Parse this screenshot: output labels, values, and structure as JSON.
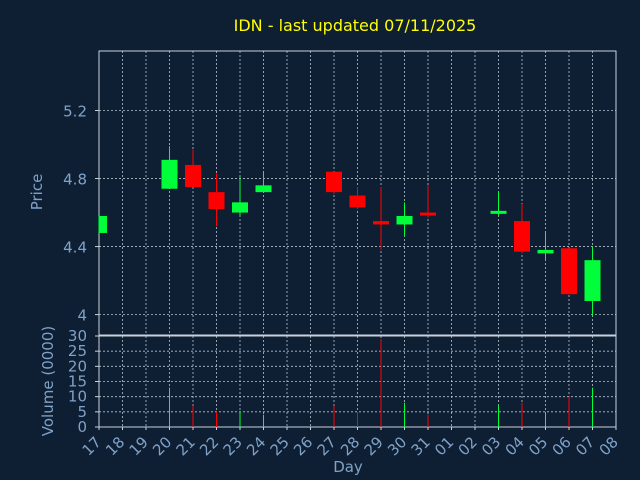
{
  "chart_data": {
    "type": "candlestick",
    "title": "IDN - last updated 07/11/2025",
    "xlabel": "Day",
    "colors": {
      "background": "#0f1f33",
      "title": "#ffff00",
      "axis_text": "#7fa2c8",
      "grid": "#c8d2dc",
      "up": "#00ff3a",
      "down": "#ff0000"
    },
    "categories": [
      "17",
      "18",
      "19",
      "20",
      "21",
      "22",
      "23",
      "24",
      "25",
      "26",
      "27",
      "28",
      "29",
      "30",
      "31",
      "01",
      "02",
      "03",
      "04",
      "05",
      "06",
      "07",
      "08"
    ],
    "price_panel": {
      "ylabel": "Price",
      "ylim": [
        3.88,
        5.55
      ],
      "yticks": [
        {
          "value": 4.0,
          "label": "4"
        },
        {
          "value": 4.4,
          "label": "4.4"
        },
        {
          "value": 4.8,
          "label": "4.8"
        },
        {
          "value": 5.2,
          "label": "5.2"
        }
      ],
      "candles": [
        {
          "day": "17",
          "open": 4.48,
          "high": 4.58,
          "low": 4.48,
          "close": 4.58
        },
        {
          "day": "20",
          "open": 4.74,
          "high": 4.99,
          "low": 4.74,
          "close": 4.91
        },
        {
          "day": "21",
          "open": 4.88,
          "high": 4.97,
          "low": 4.75,
          "close": 4.75
        },
        {
          "day": "22",
          "open": 4.72,
          "high": 4.83,
          "low": 4.52,
          "close": 4.62
        },
        {
          "day": "23",
          "open": 4.6,
          "high": 4.81,
          "low": 4.58,
          "close": 4.66
        },
        {
          "day": "24",
          "open": 4.72,
          "high": 4.84,
          "low": 4.72,
          "close": 4.76
        },
        {
          "day": "27",
          "open": 4.84,
          "high": 4.84,
          "low": 4.71,
          "close": 4.72
        },
        {
          "day": "28",
          "open": 4.7,
          "high": 4.75,
          "low": 4.62,
          "close": 4.63
        },
        {
          "day": "29",
          "open": 4.55,
          "high": 4.75,
          "low": 4.38,
          "close": 4.53
        },
        {
          "day": "30",
          "open": 4.53,
          "high": 4.66,
          "low": 4.46,
          "close": 4.58
        },
        {
          "day": "31",
          "open": 4.6,
          "high": 4.76,
          "low": 4.57,
          "close": 4.59
        },
        {
          "day": "03",
          "open": 4.6,
          "high": 4.72,
          "low": 4.58,
          "close": 4.61
        },
        {
          "day": "04",
          "open": 4.55,
          "high": 4.65,
          "low": 4.36,
          "close": 4.37
        },
        {
          "day": "05",
          "open": 4.36,
          "high": 4.48,
          "low": 4.32,
          "close": 4.38
        },
        {
          "day": "06",
          "open": 4.39,
          "high": 4.39,
          "low": 4.12,
          "close": 4.12
        },
        {
          "day": "07",
          "open": 4.08,
          "high": 4.4,
          "low": 3.99,
          "close": 4.32
        }
      ]
    },
    "volume_panel": {
      "ylabel": "Volume (0000)",
      "ylim": [
        0,
        30
      ],
      "yticks": [
        0,
        5,
        10,
        15,
        20,
        25,
        30
      ],
      "bars": [
        {
          "day": "20",
          "value": 13,
          "direction": "up"
        },
        {
          "day": "21",
          "value": 7,
          "direction": "down"
        },
        {
          "day": "22",
          "value": 5,
          "direction": "down"
        },
        {
          "day": "23",
          "value": 5,
          "direction": "up"
        },
        {
          "day": "24",
          "value": 4,
          "direction": "up"
        },
        {
          "day": "27",
          "value": 7,
          "direction": "down"
        },
        {
          "day": "28",
          "value": 5,
          "direction": "down"
        },
        {
          "day": "29",
          "value": 29,
          "direction": "down"
        },
        {
          "day": "30",
          "value": 8,
          "direction": "up"
        },
        {
          "day": "31",
          "value": 4,
          "direction": "down"
        },
        {
          "day": "03",
          "value": 7,
          "direction": "up"
        },
        {
          "day": "04",
          "value": 8,
          "direction": "down"
        },
        {
          "day": "05",
          "value": 5,
          "direction": "up"
        },
        {
          "day": "06",
          "value": 10,
          "direction": "down"
        },
        {
          "day": "07",
          "value": 13,
          "direction": "up"
        }
      ]
    }
  }
}
